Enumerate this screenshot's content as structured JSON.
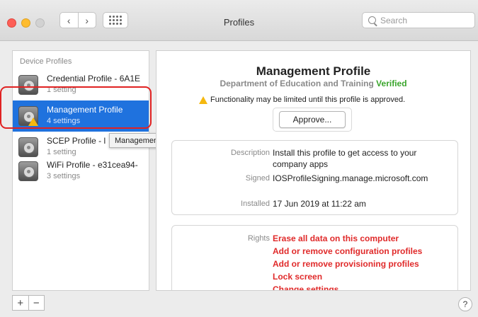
{
  "window": {
    "title": "Profiles",
    "search_placeholder": "Search",
    "nav_back": "‹",
    "nav_forward": "›"
  },
  "sidebar": {
    "header": "Device Profiles",
    "items": [
      {
        "title": "Credential Profile - 6A1E",
        "subtitle": "1 setting",
        "selected": false
      },
      {
        "title": "Management Profile",
        "subtitle": "4 settings",
        "selected": true
      },
      {
        "title": "SCEP Profile - l",
        "subtitle": "1 setting",
        "selected": false
      },
      {
        "title": "WiFi Profile - e31cea94-",
        "subtitle": "3 settings",
        "selected": false
      }
    ],
    "add_label": "+",
    "remove_label": "−"
  },
  "tooltip": "Management Profile",
  "detail": {
    "title": "Management Profile",
    "organization": "Department of Education and Training",
    "verified": "Verified",
    "warning": "Functionality may be limited until this profile is approved.",
    "approve_label": "Approve...",
    "description_label": "Description",
    "description": "Install this profile to get access to your company apps",
    "signed_label": "Signed",
    "signed": "IOSProfileSigning.manage.microsoft.com",
    "installed_label": "Installed",
    "installed": "17 Jun 2019 at 11:22 am",
    "rights_label": "Rights",
    "rights": [
      "Erase all data on this computer",
      "Add or remove configuration profiles",
      "Add or remove provisioning profiles",
      "Lock screen",
      "Change settings"
    ]
  },
  "help_label": "?",
  "colors": {
    "selection": "#1f72de",
    "verified": "#3aa52c",
    "rights": "#e02a2a",
    "warning": "#f5b80f",
    "highlight": "#e02222"
  }
}
